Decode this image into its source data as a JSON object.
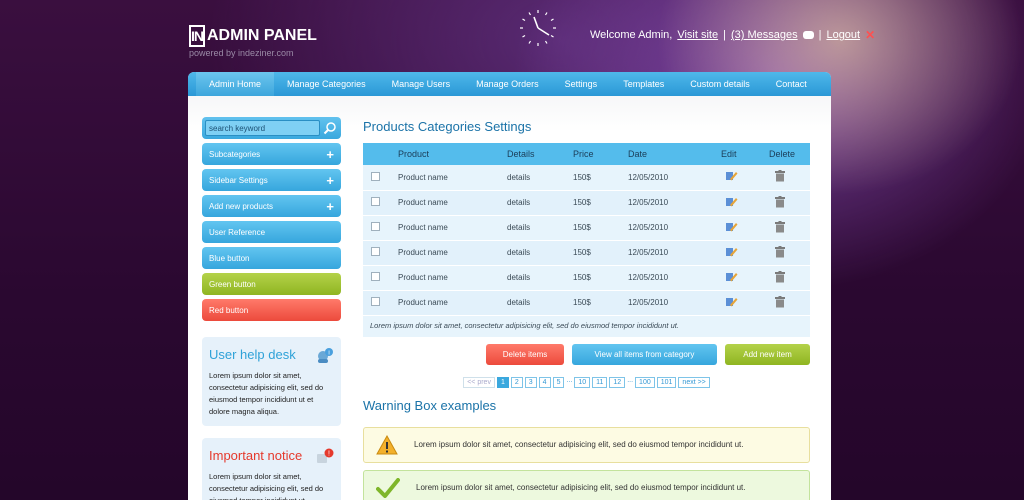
{
  "header": {
    "logo_mark": "IN",
    "logo_text": "ADMIN PANEL",
    "logo_sub": "powered by indeziner.com",
    "welcome": "Welcome Admin,",
    "visit_site": "Visit site",
    "separator": "|",
    "messages": "(3) Messages",
    "logout": "Logout"
  },
  "nav": {
    "items": [
      "Admin Home",
      "Manage Categories",
      "Manage Users",
      "Manage Orders",
      "Settings",
      "Templates",
      "Custom details",
      "Contact"
    ]
  },
  "sidebar": {
    "search_placeholder": "search keyword",
    "buttons": [
      "Subcategories",
      "Sidebar Settings",
      "Add new products",
      "User Reference",
      "Blue button",
      "Green button",
      "Red button"
    ],
    "plus": "+",
    "help_title": "User help desk",
    "help_text": "Lorem ipsum dolor sit amet, consectetur adipisicing elit, sed do eiusmod tempor incididunt ut et dolore magna aliqua.",
    "notice_title": "Important notice",
    "notice_text": "Lorem ipsum dolor sit amet, consectetur adipisicing elit, sed do eiusmod tempor incididunt ut"
  },
  "main": {
    "title": "Products Categories Settings",
    "columns": [
      "Product",
      "Details",
      "Price",
      "Date",
      "Edit",
      "Delete"
    ],
    "rows": [
      {
        "product": "Product name",
        "details": "details",
        "price": "150$",
        "date": "12/05/2010"
      },
      {
        "product": "Product name",
        "details": "details",
        "price": "150$",
        "date": "12/05/2010"
      },
      {
        "product": "Product name",
        "details": "details",
        "price": "150$",
        "date": "12/05/2010"
      },
      {
        "product": "Product name",
        "details": "details",
        "price": "150$",
        "date": "12/05/2010"
      },
      {
        "product": "Product name",
        "details": "details",
        "price": "150$",
        "date": "12/05/2010"
      },
      {
        "product": "Product name",
        "details": "details",
        "price": "150$",
        "date": "12/05/2010"
      }
    ],
    "footnote": "Lorem ipsum dolor sit amet, consectetur adipisicing elit, sed do eiusmod tempor incididunt ut.",
    "delete_items": "Delete items",
    "view_all": "View all items from category",
    "add_new": "Add new item",
    "pager": {
      "prev": "<< prev",
      "pages": [
        "1",
        "2",
        "3",
        "4",
        "5"
      ],
      "pages2": [
        "10",
        "11",
        "12"
      ],
      "pages3": [
        "100",
        "101"
      ],
      "ellipsis": "...",
      "next": "next >>",
      "current": "1"
    },
    "warning_title": "Warning Box examples",
    "warning_text": "Lorem ipsum dolor sit amet, consectetur adipisicing elit, sed do eiusmod tempor incididunt ut.",
    "success_text": "Lorem ipsum dolor sit amet, consectetur adipisicing elit, sed do eiusmod tempor incididunt ut."
  },
  "colors": {
    "accent_blue": "#36a6dd",
    "green": "#8fb521",
    "red": "#ec4a3c",
    "background": "#2a0830"
  },
  "icons": [
    "clock-icon",
    "speech-bubble-icon",
    "close-x-icon",
    "magnifier-icon",
    "plus-icon",
    "edit-pencil-icon",
    "trash-icon",
    "help-chat-icon",
    "warning-triangle-icon",
    "checkmark-icon"
  ]
}
